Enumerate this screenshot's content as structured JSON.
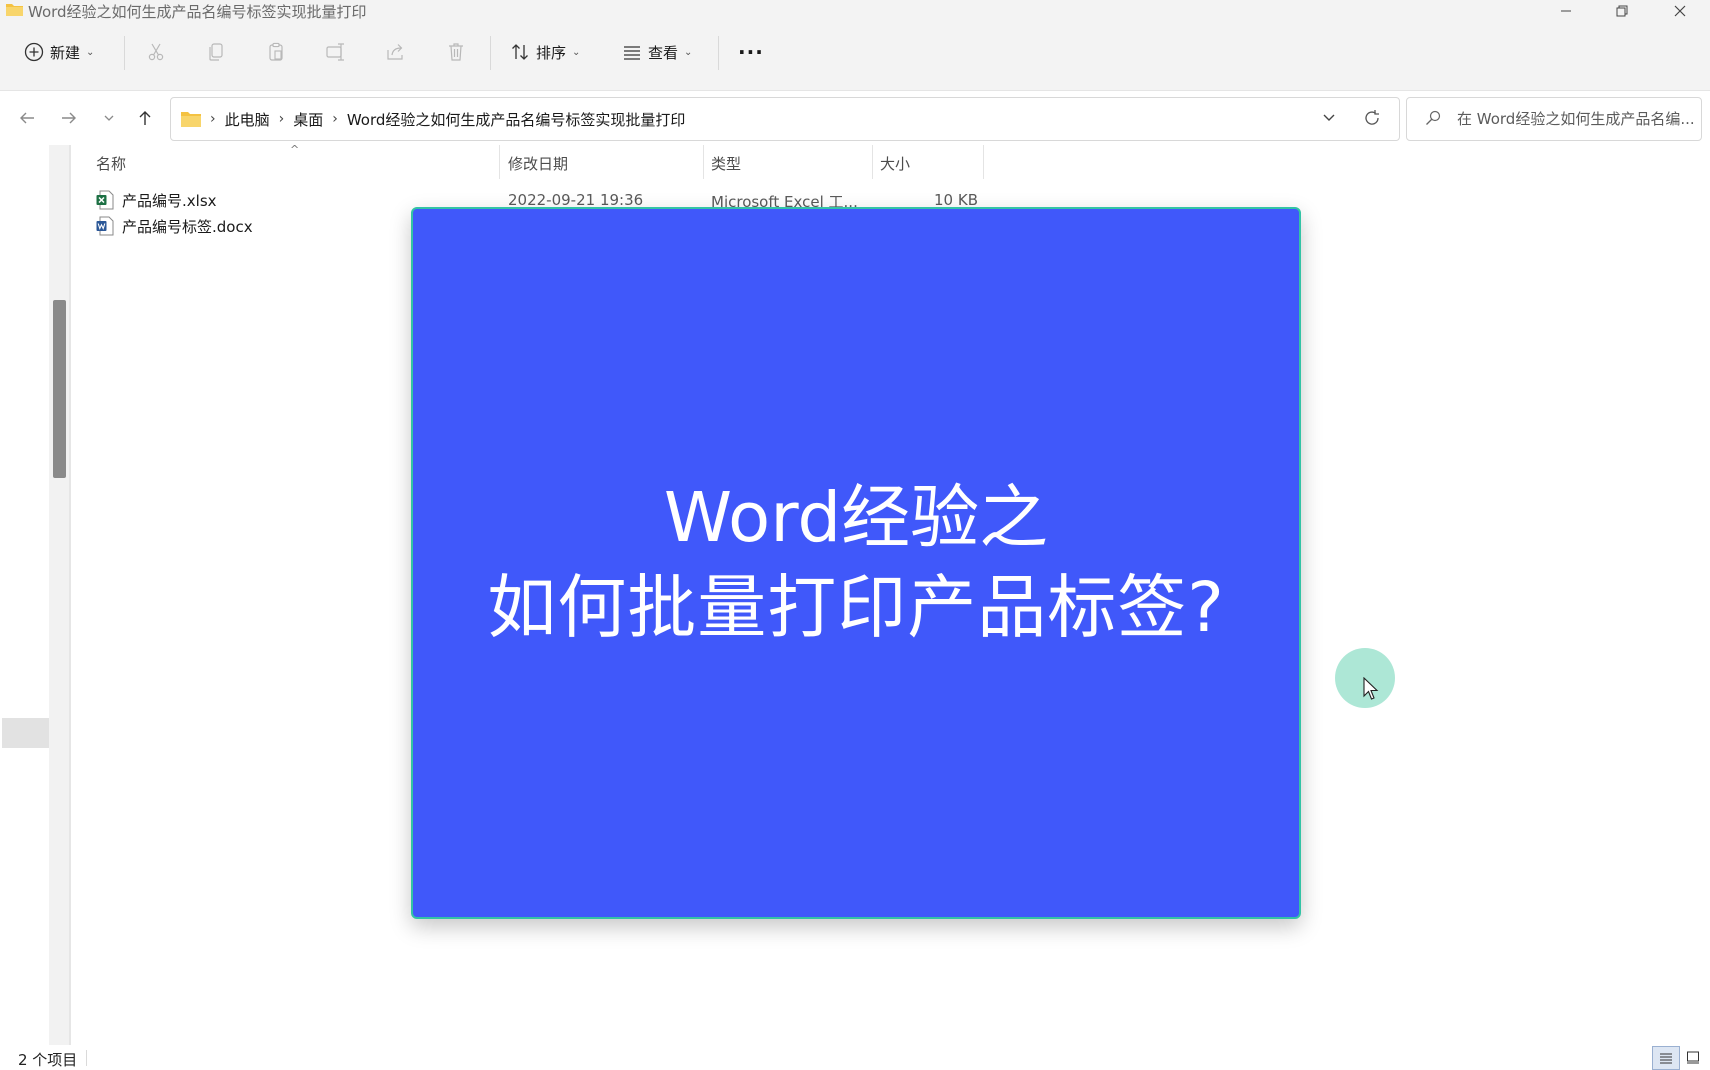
{
  "window": {
    "title": "Word经验之如何生成产品名编号标签实现批量打印",
    "minimize_glyph": "—",
    "maximize_glyph": "❐",
    "close_glyph": "✕"
  },
  "toolbar": {
    "new_label": "新建",
    "sort_label": "排序",
    "view_label": "查看",
    "more_glyph": "···",
    "icons": [
      "cut-icon",
      "copy-icon",
      "paste-icon",
      "rename-icon",
      "share-icon",
      "delete-icon"
    ]
  },
  "address": {
    "crumbs": [
      "此电脑",
      "桌面",
      "Word经验之如何生成产品名编号标签实现批量打印"
    ],
    "separator": "›"
  },
  "search": {
    "placeholder": "在 Word经验之如何生成产品名编..."
  },
  "columns": {
    "name": "名称",
    "modified": "修改日期",
    "type": "类型",
    "size": "大小"
  },
  "files": [
    {
      "name": "产品编号.xlsx",
      "modified": "2022-09-21 19:36",
      "type": "Microsoft Excel 工...",
      "size": "10 KB",
      "icon": "excel-file-icon"
    },
    {
      "name": "产品编号标签.docx",
      "icon": "word-file-icon"
    }
  ],
  "overlay": {
    "line1": "Word经验之",
    "line2": "如何批量打印产品标签?",
    "background": "#4058fa",
    "border": "#33c3a5"
  },
  "status": {
    "count": "2 个项目"
  },
  "colors": {
    "chrome_bg": "#f3f3f3",
    "folder": "#f4c242",
    "excel": "#1d7044",
    "word": "#2b5797",
    "cursor_halo": "#9fe3cf"
  }
}
